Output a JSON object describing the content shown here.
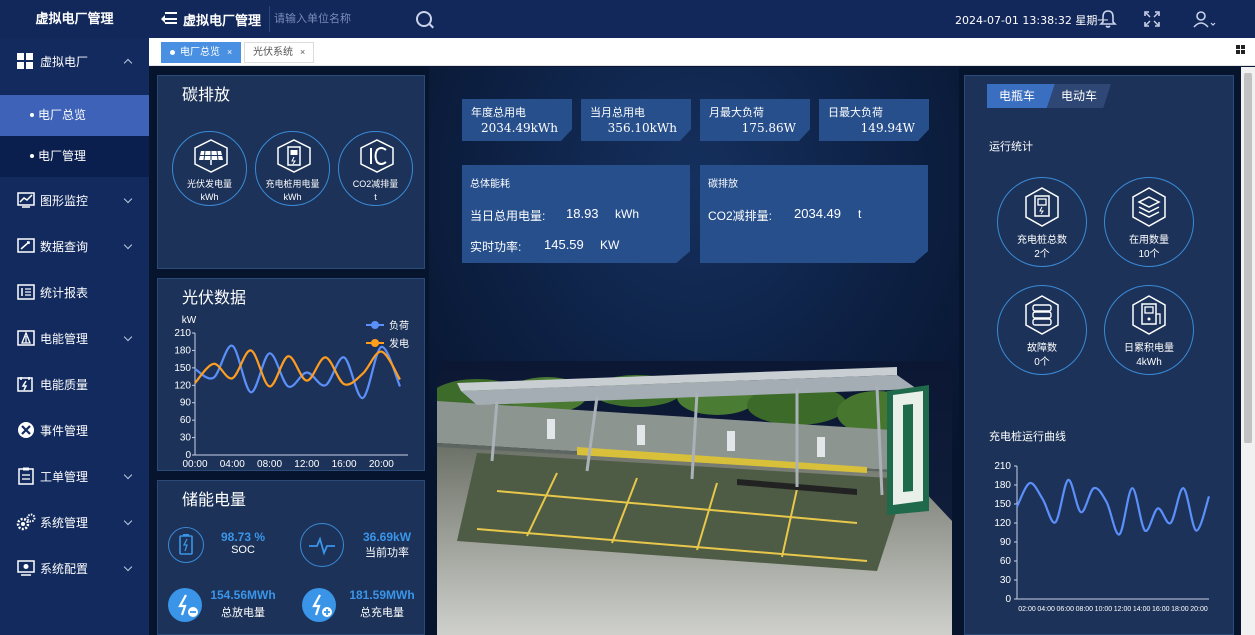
{
  "topbar": {
    "brand": "虚拟电厂管理",
    "title": "虚拟电厂管理",
    "search_placeholder": "请输入单位名称",
    "datetime": "2024-07-01 13:38:32 星期一"
  },
  "sidebar": {
    "items": [
      {
        "label": "虚拟电厂",
        "icon": "grid-icon",
        "expanded": true,
        "children": [
          {
            "label": "电厂总览",
            "active": true
          },
          {
            "label": "电厂管理",
            "active": false
          }
        ]
      },
      {
        "label": "图形监控",
        "icon": "monitor-chart-icon"
      },
      {
        "label": "数据查询",
        "icon": "data-query-icon"
      },
      {
        "label": "统计报表",
        "icon": "report-icon"
      },
      {
        "label": "电能管理",
        "icon": "energy-manage-icon"
      },
      {
        "label": "电能质量",
        "icon": "power-quality-icon"
      },
      {
        "label": "事件管理",
        "icon": "event-icon"
      },
      {
        "label": "工单管理",
        "icon": "work-order-icon"
      },
      {
        "label": "系统管理",
        "icon": "gears-icon"
      },
      {
        "label": "系统配置",
        "icon": "system-config-icon"
      }
    ]
  },
  "tabs": [
    {
      "label": "电厂总览",
      "active": true
    },
    {
      "label": "光伏系统",
      "active": false
    }
  ],
  "carbon": {
    "title": "碳排放",
    "badges": [
      {
        "label": "光伏发电量",
        "unit": "kWh",
        "icon": "solar-panel-icon"
      },
      {
        "label": "充电桩用电量",
        "unit": "kWh",
        "icon": "charger-icon"
      },
      {
        "label": "CO2减排量",
        "unit": "t",
        "icon": "co2-icon"
      }
    ]
  },
  "stats": [
    {
      "label": "年度总用电",
      "value": "2034.49kWh"
    },
    {
      "label": "当月总用电",
      "value": "356.10kWh"
    },
    {
      "label": "月最大负荷",
      "value": "175.86W"
    },
    {
      "label": "日最大负荷",
      "value": "149.94W"
    }
  ],
  "energy": {
    "title": "总体能耗",
    "daily_label": "当日总用电量:",
    "daily_value": "18.93",
    "daily_unit": "kWh",
    "power_label": "实时功率:",
    "power_value": "145.59",
    "power_unit": "KW"
  },
  "emission": {
    "title": "碳排放",
    "co2_label": "CO2减排量:",
    "co2_value": "2034.49",
    "co2_unit": "t"
  },
  "pv": {
    "title": "光伏数据"
  },
  "storage": {
    "title": "储能电量",
    "soc_value": "98.73 %",
    "soc_label": "SOC",
    "power_value": "36.69kW",
    "power_label": "当前功率",
    "discharge_value": "154.56MWh",
    "discharge_label": "总放电量",
    "charge_value": "181.59MWh",
    "charge_label": "总充电量"
  },
  "right": {
    "tabs": [
      {
        "label": "电瓶车",
        "active": true
      },
      {
        "label": "电动车",
        "active": false
      }
    ],
    "run_stats_title": "运行统计",
    "circles": [
      {
        "label": "充电桩总数",
        "value": "2个",
        "icon": "charger-pile-icon"
      },
      {
        "label": "在用数量",
        "value": "10个",
        "icon": "layers-icon"
      },
      {
        "label": "故障数",
        "value": "0个",
        "icon": "database-icon"
      },
      {
        "label": "日累积电量",
        "value": "4kWh",
        "icon": "charger-plug-icon"
      }
    ],
    "curve_title": "充电桩运行曲线"
  },
  "colors": {
    "load": "#5b8ff9",
    "gen": "#ff9d1f",
    "accent": "#3a8ad6",
    "panel": "#1c3259",
    "sidebar": "#122a5e"
  },
  "chart_data": [
    {
      "type": "line",
      "ylabel": "kW",
      "ylim": [
        0,
        210
      ],
      "yticks": [
        0,
        30,
        60,
        90,
        120,
        150,
        180,
        210
      ],
      "x": [
        "00:00",
        "02:00",
        "04:00",
        "06:00",
        "08:00",
        "10:00",
        "12:00",
        "14:00",
        "16:00",
        "18:00",
        "20:00",
        "22:00"
      ],
      "xticks": [
        "00:00",
        "04:00",
        "08:00",
        "12:00",
        "16:00",
        "20:00"
      ],
      "series": [
        {
          "name": "负荷",
          "values": [
            148,
            133,
            188,
            108,
            175,
            118,
            142,
            120,
            168,
            98,
            186,
            118
          ]
        },
        {
          "name": "发电",
          "values": [
            124,
            157,
            132,
            180,
            118,
            170,
            128,
            168,
            122,
            140,
            178,
            130
          ]
        }
      ],
      "legend": "top-right",
      "grid": false
    },
    {
      "type": "line",
      "ylim": [
        0,
        210
      ],
      "yticks": [
        0,
        30,
        60,
        90,
        120,
        150,
        180,
        210
      ],
      "x": [
        "02:00",
        "04:00",
        "06:00",
        "08:00",
        "10:00",
        "12:00",
        "14:00",
        "16:00",
        "18:00",
        "20:00"
      ],
      "xticks": [
        "02:00",
        "04:00",
        "06:00",
        "08:00",
        "10:00",
        "12:00",
        "14:00",
        "16:00",
        "18:00",
        "20:00"
      ],
      "series": [
        {
          "values": [
            146,
            183,
            158,
            121,
            188,
            137,
            175,
            153,
            102,
            175,
            108,
            143,
            120,
            175,
            108,
            162
          ]
        }
      ],
      "grid": false
    }
  ]
}
